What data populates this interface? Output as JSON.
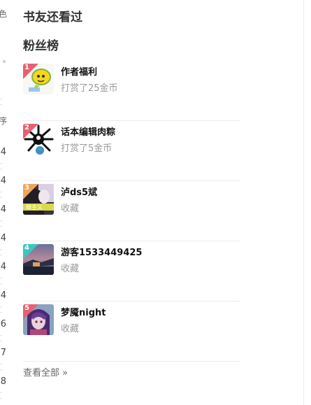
{
  "left_strip": {
    "top_char": "色",
    "mid_char": "序",
    "numbers": [
      "4",
      "4",
      "4",
      "4",
      "4",
      "4",
      "6",
      "7",
      "8"
    ]
  },
  "section_read": {
    "title": "书友还看过"
  },
  "section_fans": {
    "title": "粉丝榜",
    "fans": [
      {
        "rank": "1",
        "name": "作者福利",
        "action": "打赏了25金币",
        "rank_color": "#e8606f"
      },
      {
        "rank": "2",
        "name": "话本编辑肉粽",
        "action": "打赏了5金币",
        "rank_color": "#e8606f"
      },
      {
        "rank": "3",
        "name": "泸ds5斌",
        "action": "收藏",
        "rank_color": "#f2a25a"
      },
      {
        "rank": "4",
        "name": "游客1533449425",
        "action": "收藏",
        "rank_color": "#3cc6c0"
      },
      {
        "rank": "5",
        "name": "梦魇night",
        "action": "收藏",
        "rank_color": "#e8606f"
      }
    ],
    "avatar3_text": "騎主义"
  },
  "view_all": {
    "label": "查看全部 »"
  }
}
